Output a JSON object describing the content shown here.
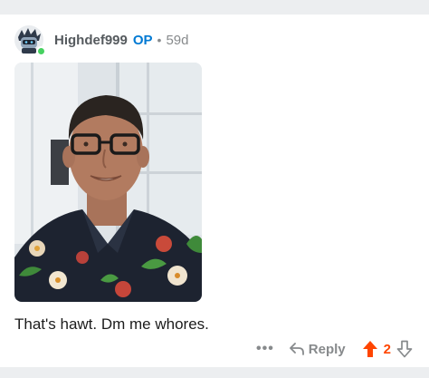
{
  "comment": {
    "author": "Highdef999",
    "op_badge": "OP",
    "separator": "•",
    "age": "59d",
    "avatar_icon": "avatar-icon",
    "online_color": "#46d160",
    "image_alt": "photo",
    "text": "That's hawt. Dm me whores."
  },
  "actions": {
    "more_label": "•••",
    "reply_label": "Reply",
    "upvote_icon": "arrow-up-icon",
    "score": "2",
    "downvote_icon": "arrow-down-icon",
    "upvote_color": "#ff4500"
  }
}
